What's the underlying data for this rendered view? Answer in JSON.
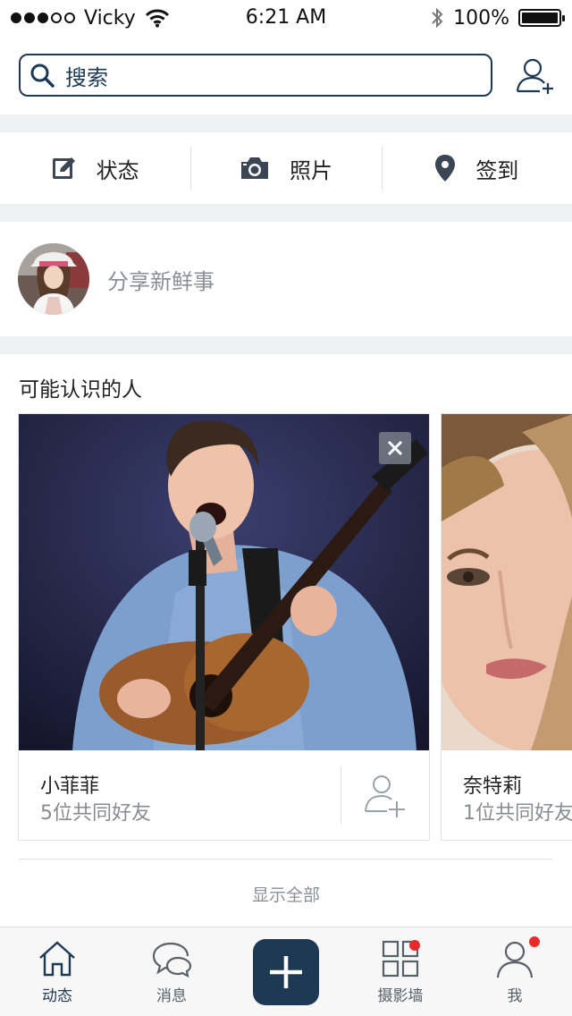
{
  "status_bar": {
    "carrier": "Vicky",
    "time": "6:21 AM",
    "battery": "100%",
    "battery_level": 1.0
  },
  "search": {
    "placeholder": "搜索"
  },
  "actions": [
    {
      "label": "状态",
      "icon": "edit-icon"
    },
    {
      "label": "照片",
      "icon": "camera-icon"
    },
    {
      "label": "签到",
      "icon": "location-pin-icon"
    }
  ],
  "share": {
    "placeholder": "分享新鲜事"
  },
  "people_you_may_know": {
    "title": "可能认识的人",
    "cards": [
      {
        "name": "小菲菲",
        "mutual": "5位共同好友"
      },
      {
        "name": "奈特莉",
        "mutual": "1位共同好友"
      }
    ],
    "show_all": "显示全部"
  },
  "tabs": [
    {
      "label": "动态",
      "icon": "home-icon",
      "active": true
    },
    {
      "label": "消息",
      "icon": "chat-bubbles-icon",
      "active": false
    },
    {
      "label": "",
      "icon": "plus-icon",
      "active": false
    },
    {
      "label": "摄影墙",
      "icon": "grid-icon",
      "active": false
    },
    {
      "label": "我",
      "icon": "user-icon",
      "active": false
    }
  ],
  "colors": {
    "brand": "#1e3954",
    "badge": "#e62b2b",
    "background": "#eef1f2"
  }
}
